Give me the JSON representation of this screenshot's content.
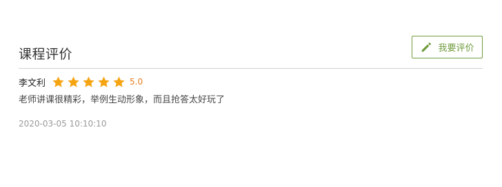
{
  "section": {
    "title": "课程评价",
    "review_button_label": "我要评价"
  },
  "review": {
    "reviewer": "李文利",
    "rating": 5,
    "score_text": "5.0",
    "comment": "老师讲课很精彩，举例生动形象，而且抢答太好玩了",
    "timestamp": "2020-03-05 10:10:10"
  },
  "colors": {
    "accent_green": "#6f9b3d",
    "star": "#f5a412",
    "score": "#e87a1d"
  },
  "icons": {
    "review_button": "pencil-icon",
    "rating": "star-icon"
  }
}
